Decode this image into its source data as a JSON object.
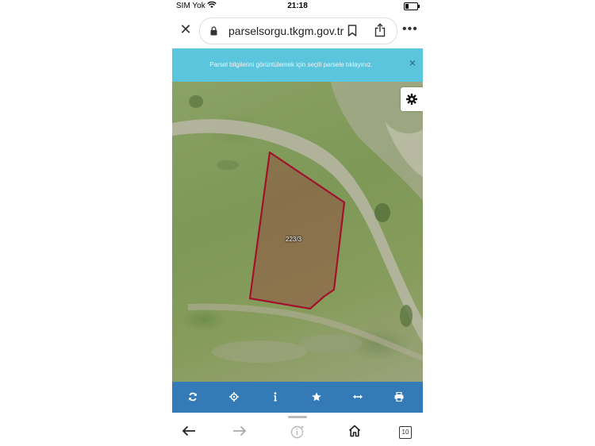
{
  "status_bar": {
    "carrier": "SIM Yok",
    "time": "21:18"
  },
  "address_bar": {
    "url": "parselsorgu.tkgm.gov.tr"
  },
  "banner": {
    "message": "Parsel bilgilerini görüntülemek için seçili parsele tıklayınız.",
    "close_symbol": "×"
  },
  "map": {
    "parcel_label": "223/3",
    "parcel_outline_color": "#a3102a"
  },
  "toolbar": {
    "color": "#337ab7",
    "tools": [
      "refresh-icon",
      "locate-icon",
      "info-icon",
      "favorite-icon",
      "measure-icon",
      "print-icon"
    ]
  },
  "browser_nav": {
    "tab_count": "10"
  }
}
